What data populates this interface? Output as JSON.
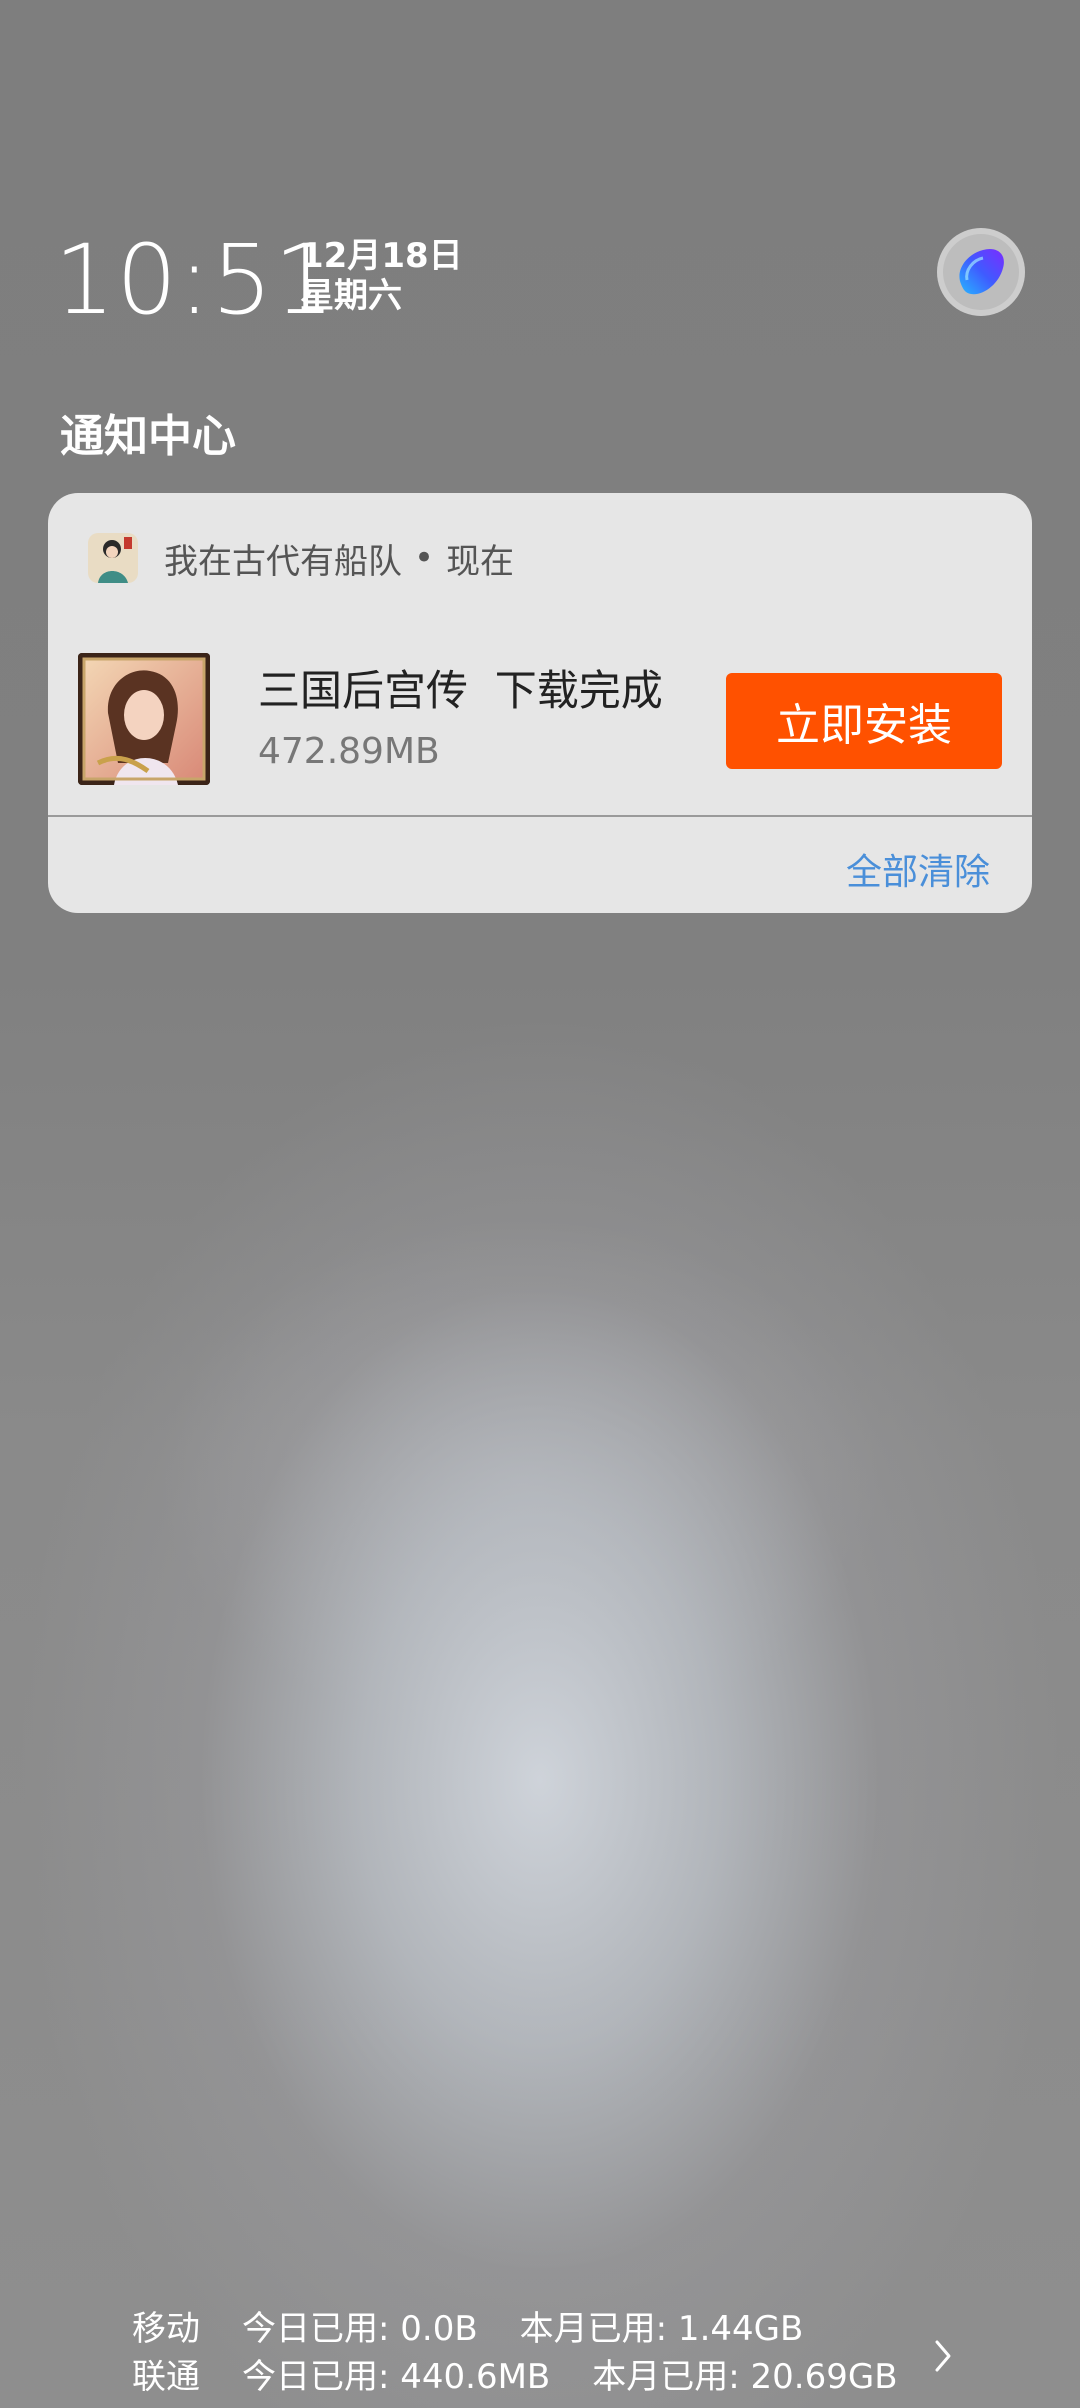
{
  "status": {
    "time": "10:51",
    "date": "12月18日",
    "weekday": "星期六"
  },
  "notification_center": {
    "title": "通知中心"
  },
  "notification": {
    "app_name": "我在古代有船队",
    "separator": "•",
    "time_ago": "现在",
    "title": "三国后宫传  下载完成",
    "size": "472.89MB",
    "action_label": "立即安装",
    "clear_all_label": "全部清除",
    "colors": {
      "action": "#ff5100",
      "clear_all": "#4a8fd9",
      "card_bg": "#e6e6e6"
    }
  },
  "data_usage": {
    "rows": [
      {
        "carrier": "移动",
        "today": "今日已用: 0.0B",
        "month": "本月已用: 1.44GB"
      },
      {
        "carrier": "联通",
        "today": "今日已用: 440.6MB",
        "month": "本月已用: 20.69GB"
      }
    ],
    "more_icon": "chevron-right-icon"
  },
  "icons": {
    "assistant": "assistant-orb-icon",
    "app_small": "app-avatar-icon",
    "game": "game-cover-icon"
  }
}
